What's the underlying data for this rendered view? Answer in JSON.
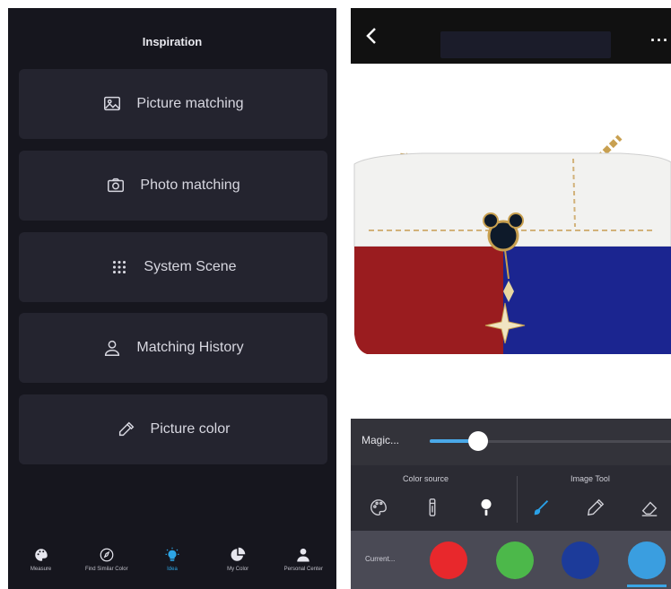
{
  "left_screen": {
    "title": "Inspiration",
    "menu": [
      {
        "label": "Picture matching",
        "icon": "image-icon"
      },
      {
        "label": "Photo matching",
        "icon": "camera-icon"
      },
      {
        "label": "System Scene",
        "icon": "grid-dots-icon"
      },
      {
        "label": "Matching History",
        "icon": "person-icon"
      },
      {
        "label": "Picture color",
        "icon": "eyedropper-icon"
      }
    ],
    "bottom_nav": [
      {
        "label": "Measure",
        "icon": "palette-icon"
      },
      {
        "label": "Find Similar Color",
        "icon": "compass-icon"
      },
      {
        "label": "Idea",
        "icon": "lightbulb-icon",
        "active": true
      },
      {
        "label": "My Color",
        "icon": "pie-chart-icon"
      },
      {
        "label": "Personal Center",
        "icon": "person-icon"
      }
    ],
    "active_color": "#2da6e6"
  },
  "right_screen": {
    "magic_label": "Magic...",
    "magic_level": 0.2,
    "color_source_label": "Color source",
    "image_tool_label": "Image Tool",
    "current_label": "Current...",
    "swatches": [
      "#e8282c",
      "#4cb84a",
      "#1c3b9a",
      "#3a9ee0"
    ],
    "tools": [
      "palette-icon",
      "tube-icon",
      "pin-icon",
      "brush-icon",
      "pencil-icon",
      "eraser-icon"
    ]
  }
}
